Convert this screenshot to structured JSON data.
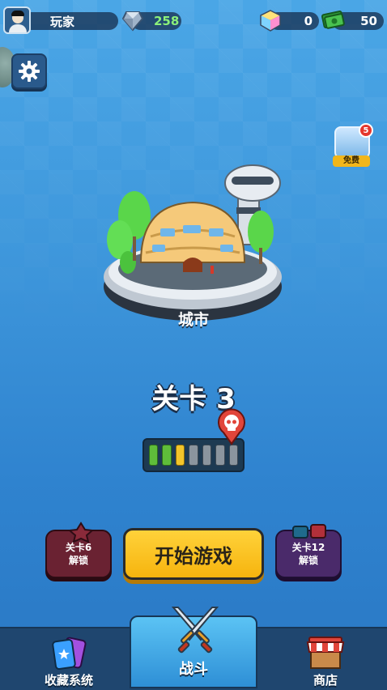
{
  "topbar": {
    "player_name": "玩家",
    "trophies": "258",
    "cubes": "0",
    "cash": "50"
  },
  "offer": {
    "badge_count": "5",
    "label": "免费"
  },
  "island": {
    "name": "城市"
  },
  "level": {
    "title": "关卡 3",
    "progress_total": 7,
    "progress_completed": 2,
    "progress_current": 3
  },
  "actions": {
    "left_unlock_line1": "关卡6",
    "left_unlock_line2": "解锁",
    "start_label": "开始游戏",
    "right_unlock_line1": "关卡12",
    "right_unlock_line2": "解锁"
  },
  "nav": {
    "collection_label": "收藏系统",
    "battle_label": "战斗",
    "shop_label": "商店"
  },
  "colors": {
    "start_button": "#f6b40e",
    "progress_done": "#5fbd3a",
    "progress_current": "#f2c52b",
    "progress_pending": "#8b959e",
    "nav_bar": "#1f466f",
    "battle_tab": "#2e8fd6"
  },
  "icons": [
    "avatar-icon",
    "trophy-gem-icon",
    "cube-icon",
    "cash-icon",
    "gear-icon",
    "gift-icon",
    "skull-icon",
    "cards-icon",
    "swords-icon",
    "shop-icon"
  ]
}
